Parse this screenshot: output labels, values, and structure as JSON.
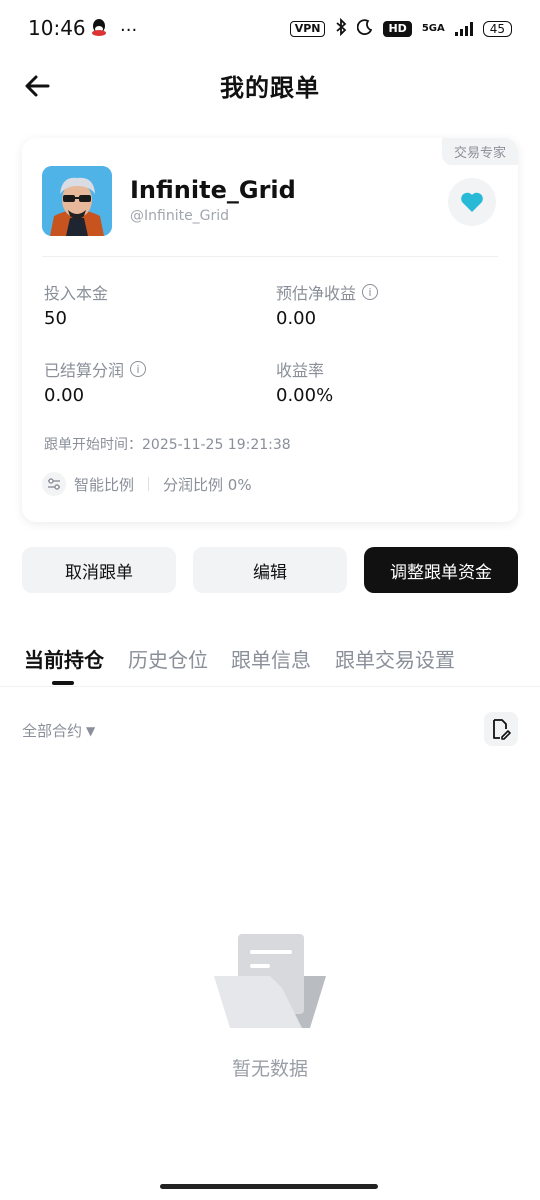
{
  "status_bar": {
    "time": "10:46",
    "left_icons": [
      "qq-icon",
      "more-dots-icon"
    ],
    "more": "···",
    "vpn": "VPN",
    "hd": "HD",
    "network": "5GA",
    "battery": "45"
  },
  "header": {
    "title": "我的跟单"
  },
  "card": {
    "tag": "交易专家",
    "trader_name": "Infinite_Grid",
    "trader_handle": "@Infinite_Grid",
    "stats": [
      {
        "label": "投入本金",
        "value": "50",
        "info": false
      },
      {
        "label": "预估净收益",
        "value": "0.00",
        "info": true
      },
      {
        "label": "已结算分润",
        "value": "0.00",
        "info": true
      },
      {
        "label": "收益率",
        "value": "0.00%",
        "info": false
      }
    ],
    "start_time": "跟单开始时间：2025-11-25 19:21:38",
    "ratio_mode": "智能比例",
    "profit_share": "分润比例 0%",
    "info_glyph": "i"
  },
  "actions": {
    "cancel": "取消跟单",
    "edit": "编辑",
    "adjust": "调整跟单资金"
  },
  "tabs": [
    {
      "label": "当前持仓",
      "active": true
    },
    {
      "label": "历史仓位",
      "active": false
    },
    {
      "label": "跟单信息",
      "active": false
    },
    {
      "label": "跟单交易设置",
      "active": false
    }
  ],
  "filter": {
    "label": "全部合约",
    "arrow": "▼"
  },
  "empty": {
    "text": "暂无数据"
  },
  "colors": {
    "accent": "#28b9d6",
    "primary": "#111111",
    "muted": "#8a8f99"
  }
}
